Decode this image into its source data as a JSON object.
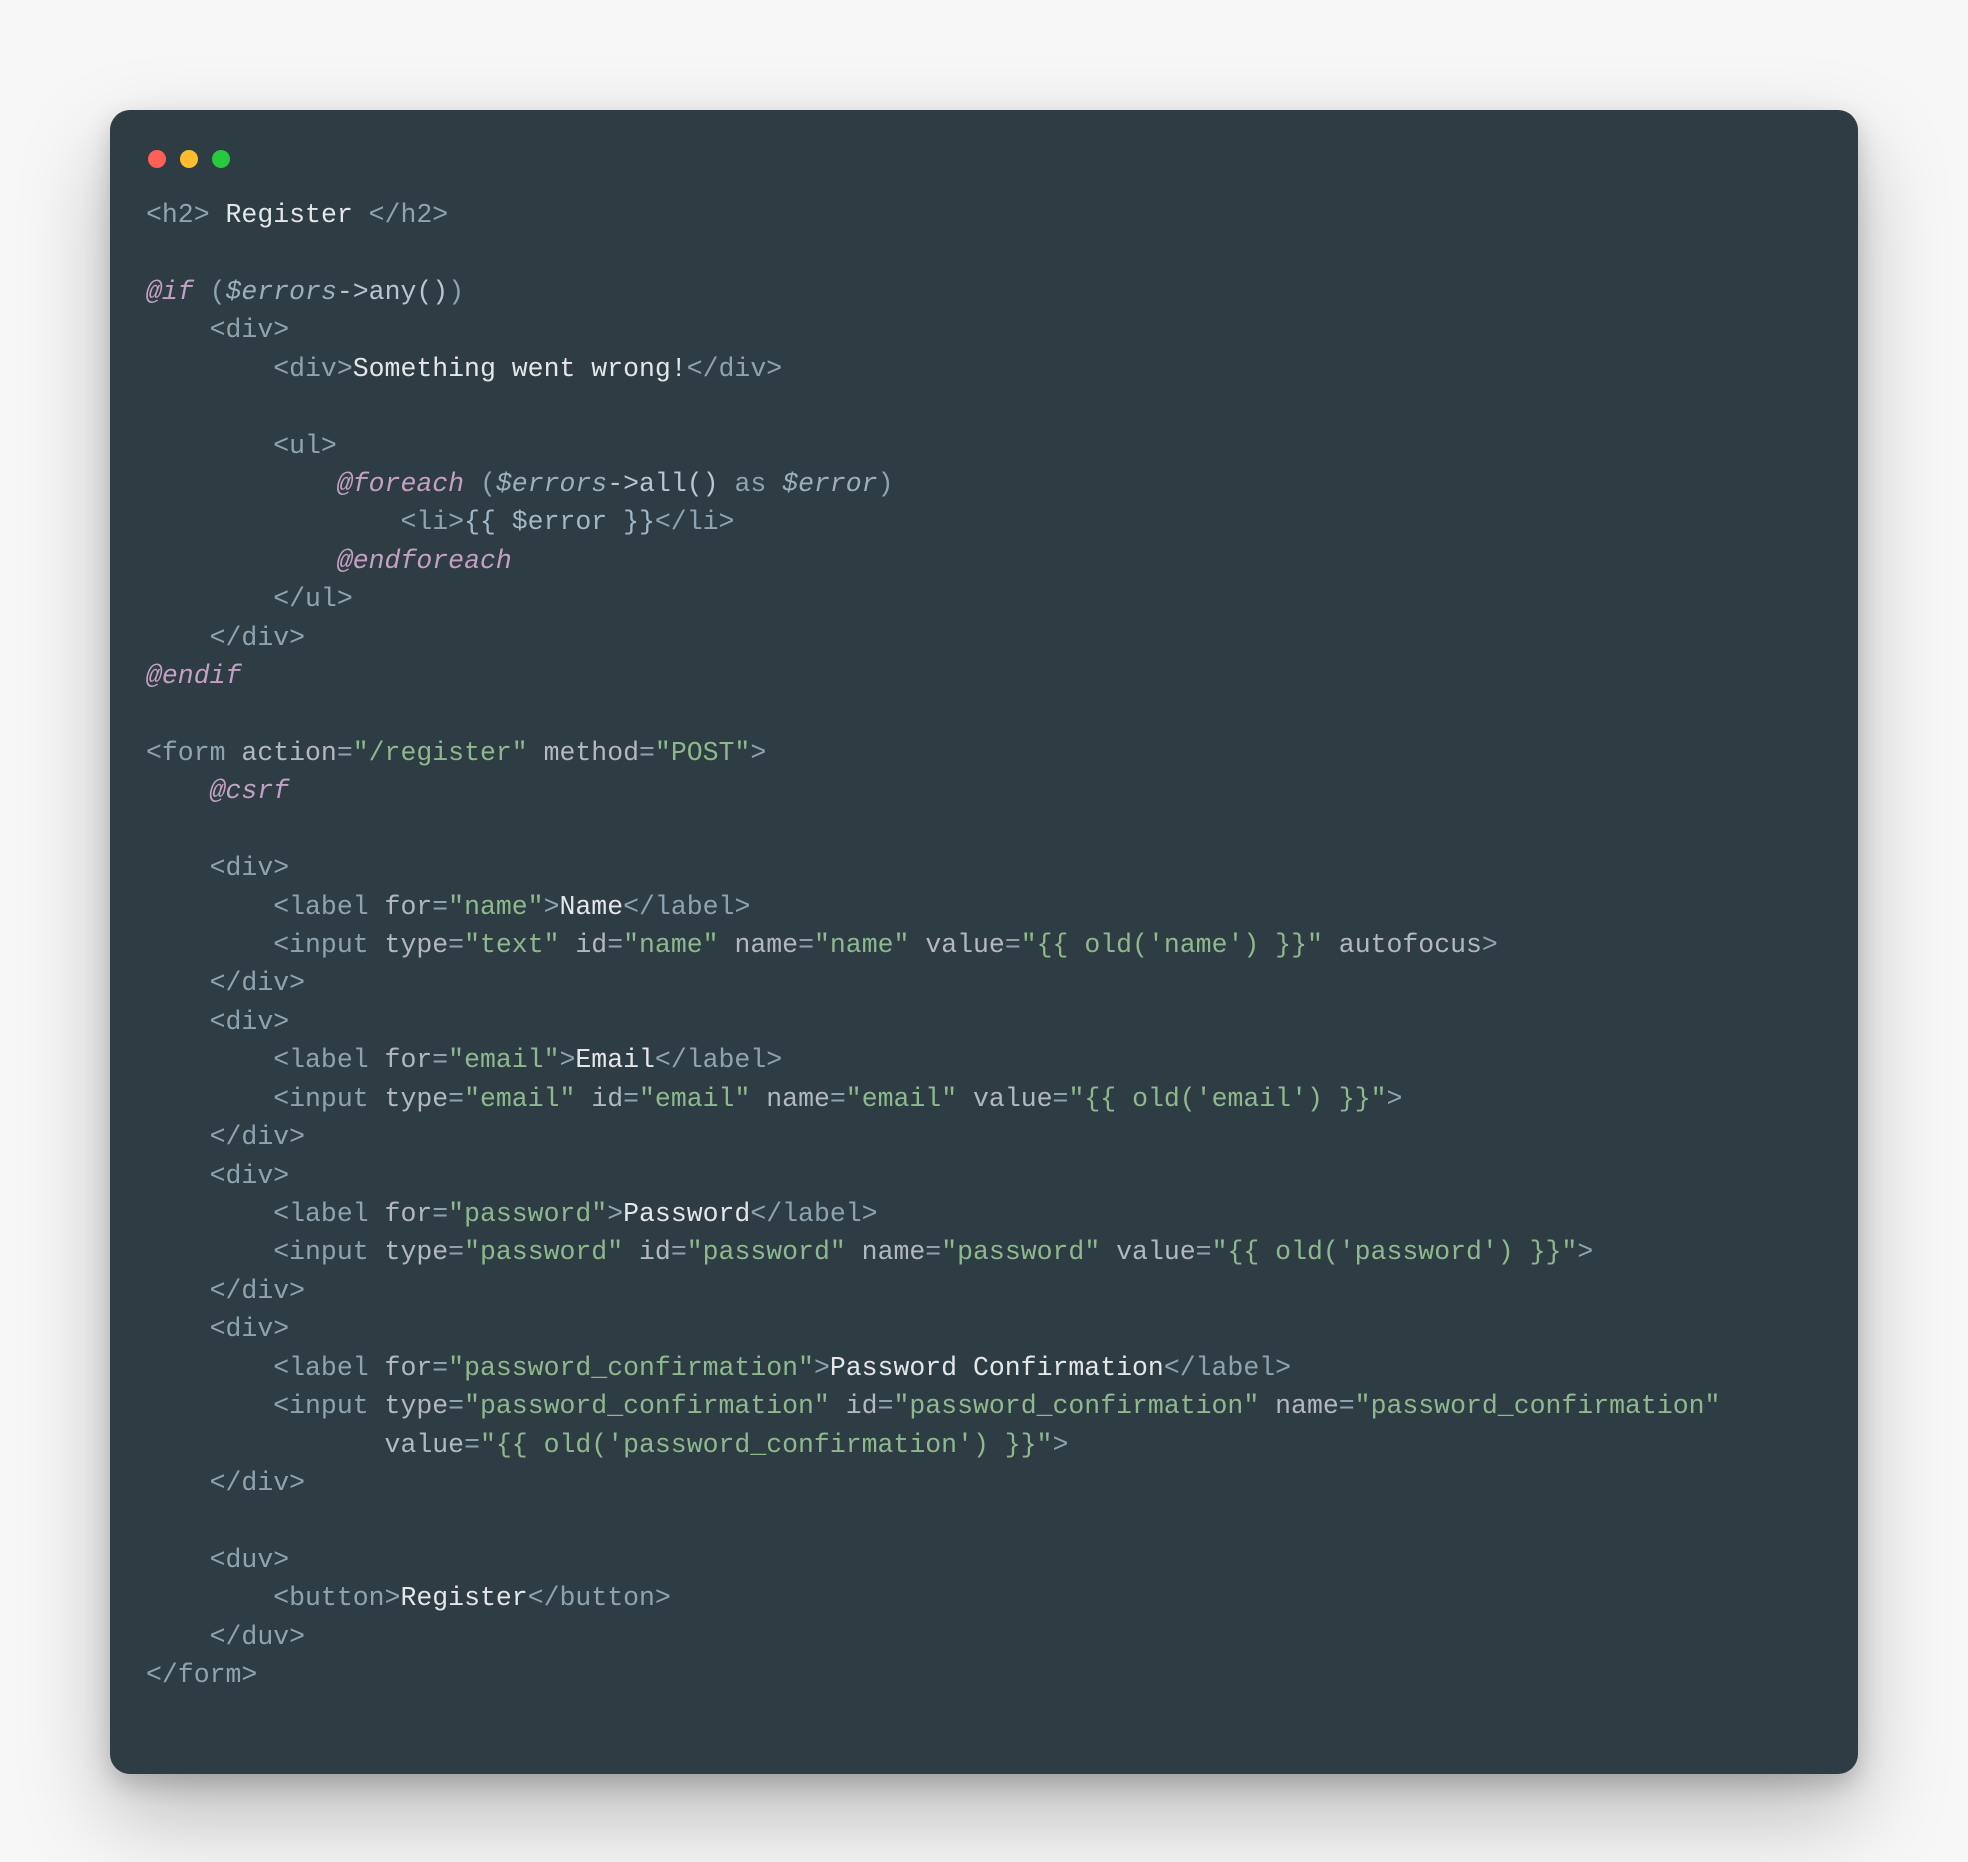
{
  "window": {
    "close": "close",
    "minimize": "minimize",
    "zoom": "zoom"
  },
  "code": {
    "l01a": "<h2>",
    "l01b": " Register ",
    "l01c": "</h2>",
    "l03a": "@if",
    "l03b": " (",
    "l03c": "$errors",
    "l03d": "->any()",
    "l03e": ")",
    "l04": "    <div>",
    "l05a": "        <div>",
    "l05b": "Something went wrong!",
    "l05c": "</div>",
    "l07": "        <ul>",
    "l08a": "            ",
    "l08b": "@foreach",
    "l08c": " (",
    "l08d": "$errors",
    "l08e": "->all()",
    "l08f": " as ",
    "l08g": "$error",
    "l08h": ")",
    "l09a": "                <li>",
    "l09b": "{{ $error }}",
    "l09c": "</li>",
    "l10a": "            ",
    "l10b": "@endforeach",
    "l11": "        </ul>",
    "l12": "    </div>",
    "l13": "@endif",
    "l15a": "<form ",
    "l15b": "action",
    "l15c": "=",
    "l15d": "\"/register\"",
    "l15e": " ",
    "l15f": "method",
    "l15g": "=",
    "l15h": "\"POST\"",
    "l15i": ">",
    "l16a": "    ",
    "l16b": "@csrf",
    "l18": "    <div>",
    "l19a": "        <label ",
    "l19b": "for",
    "l19c": "=",
    "l19d": "\"name\"",
    "l19e": ">",
    "l19f": "Name",
    "l19g": "</label>",
    "l20a": "        <input ",
    "l20b": "type",
    "l20c": "=",
    "l20d": "\"text\"",
    "l20e": " ",
    "l20f": "id",
    "l20g": "=",
    "l20h": "\"name\"",
    "l20i": " ",
    "l20j": "name",
    "l20k": "=",
    "l20l": "\"name\"",
    "l20m": " ",
    "l20n": "value",
    "l20o": "=",
    "l20p": "\"{{ old('name') }}\"",
    "l20q": " ",
    "l20r": "autofocus",
    "l20s": ">",
    "l21": "    </div>",
    "l22": "    <div>",
    "l23a": "        <label ",
    "l23b": "for",
    "l23c": "=",
    "l23d": "\"email\"",
    "l23e": ">",
    "l23f": "Email",
    "l23g": "</label>",
    "l24a": "        <input ",
    "l24b": "type",
    "l24c": "=",
    "l24d": "\"email\"",
    "l24e": " ",
    "l24f": "id",
    "l24g": "=",
    "l24h": "\"email\"",
    "l24i": " ",
    "l24j": "name",
    "l24k": "=",
    "l24l": "\"email\"",
    "l24m": " ",
    "l24n": "value",
    "l24o": "=",
    "l24p": "\"{{ old('email') }}\"",
    "l24q": ">",
    "l25": "    </div>",
    "l26": "    <div>",
    "l27a": "        <label ",
    "l27b": "for",
    "l27c": "=",
    "l27d": "\"password\"",
    "l27e": ">",
    "l27f": "Password",
    "l27g": "</label>",
    "l28a": "        <input ",
    "l28b": "type",
    "l28c": "=",
    "l28d": "\"password\"",
    "l28e": " ",
    "l28f": "id",
    "l28g": "=",
    "l28h": "\"password\"",
    "l28i": " ",
    "l28j": "name",
    "l28k": "=",
    "l28l": "\"password\"",
    "l28m": " ",
    "l28n": "value",
    "l28o": "=",
    "l28p": "\"{{ old('password') }}\"",
    "l28q": ">",
    "l29": "    </div>",
    "l30": "    <div>",
    "l31a": "        <label ",
    "l31b": "for",
    "l31c": "=",
    "l31d": "\"password_confirmation\"",
    "l31e": ">",
    "l31f": "Password Confirmation",
    "l31g": "</label>",
    "l32a": "        <input ",
    "l32b": "type",
    "l32c": "=",
    "l32d": "\"password_confirmation\"",
    "l32e": " ",
    "l32f": "id",
    "l32g": "=",
    "l32h": "\"password_confirmation\"",
    "l32i": " ",
    "l32j": "name",
    "l32k": "=",
    "l32l": "\"password_confirmation\"",
    "l33a": "               ",
    "l33b": "value",
    "l33c": "=",
    "l33d": "\"{{ old('password_confirmation') }}\"",
    "l33e": ">",
    "l34": "    </div>",
    "l36": "    <duv>",
    "l37a": "        <button>",
    "l37b": "Register",
    "l37c": "</button>",
    "l38": "    </duv>",
    "l39": "</form>"
  }
}
